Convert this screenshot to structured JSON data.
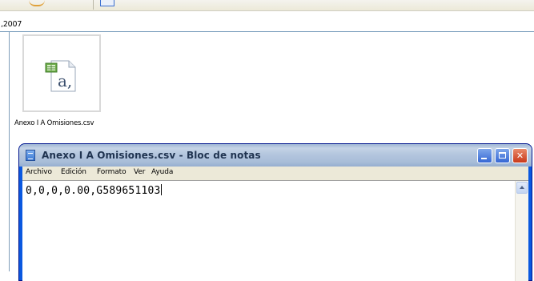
{
  "explorer": {
    "path_label": ",2007",
    "file": {
      "name": "Anexo I A Omisiones.csv",
      "icon": "excel-csv-file-icon"
    }
  },
  "notepad": {
    "title": "Anexo I A Omisiones.csv - Bloc de notas",
    "menu": [
      "Archivo",
      "Edición",
      "Formato",
      "Ver",
      "Ayuda"
    ],
    "content": "0,0,0,0.00,G589651103",
    "buttons": [
      "minimize-icon",
      "maximize-icon",
      "close-icon"
    ]
  },
  "colors": {
    "titlebar": "#b4c6de",
    "frame": "#0a58e0",
    "close_button": "#c8391a"
  }
}
